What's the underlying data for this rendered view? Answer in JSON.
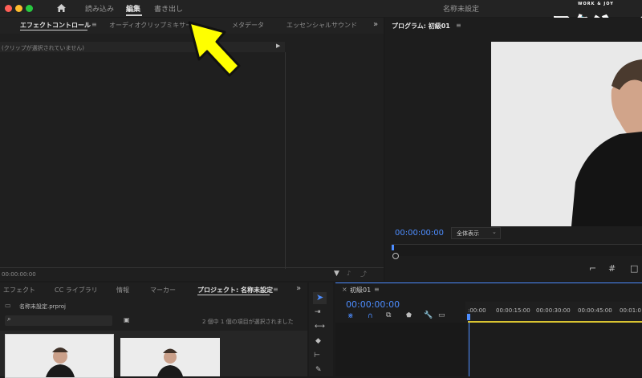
{
  "app": {
    "document_title": "名称未設定"
  },
  "workspaces": [
    "読み込み",
    "編集",
    "書き出し"
  ],
  "home_icon": "home-icon",
  "logo": {
    "small": "WORK & JOY",
    "main": "ワクジョイ"
  },
  "top_tabs": [
    "エフェクトコントロール",
    "オーディオクリップミキサー",
    "メタデータ",
    "エッセンシャルサウンド"
  ],
  "effect_controls": {
    "empty_message": "(クリップが選択されていません)",
    "timecode": "00:00:00:00"
  },
  "program": {
    "title": "プログラム: 初級01",
    "timecode": "00:00:00:00",
    "zoom": "全体表示"
  },
  "bottom_tabs": [
    "エフェクト",
    "CC ライブラリ",
    "情報",
    "マーカー",
    "プロジェクト: 名称未設定"
  ],
  "project": {
    "file": "名称未設定.prproj",
    "selection_status": "2 個中 1 個の項目が選択されました"
  },
  "timeline": {
    "sequence": "初級01",
    "timecode": "00:00:00:00",
    "ruler": [
      ":00:00",
      "00:00:15:00",
      "00:00:30:00",
      "00:00:45:00",
      "00:01:0"
    ]
  },
  "colors": {
    "accent": "#4d8dff",
    "arrow": "#ffff00",
    "logo_pink": "#ff4fa0",
    "logo_cyan": "#26c6e6"
  }
}
